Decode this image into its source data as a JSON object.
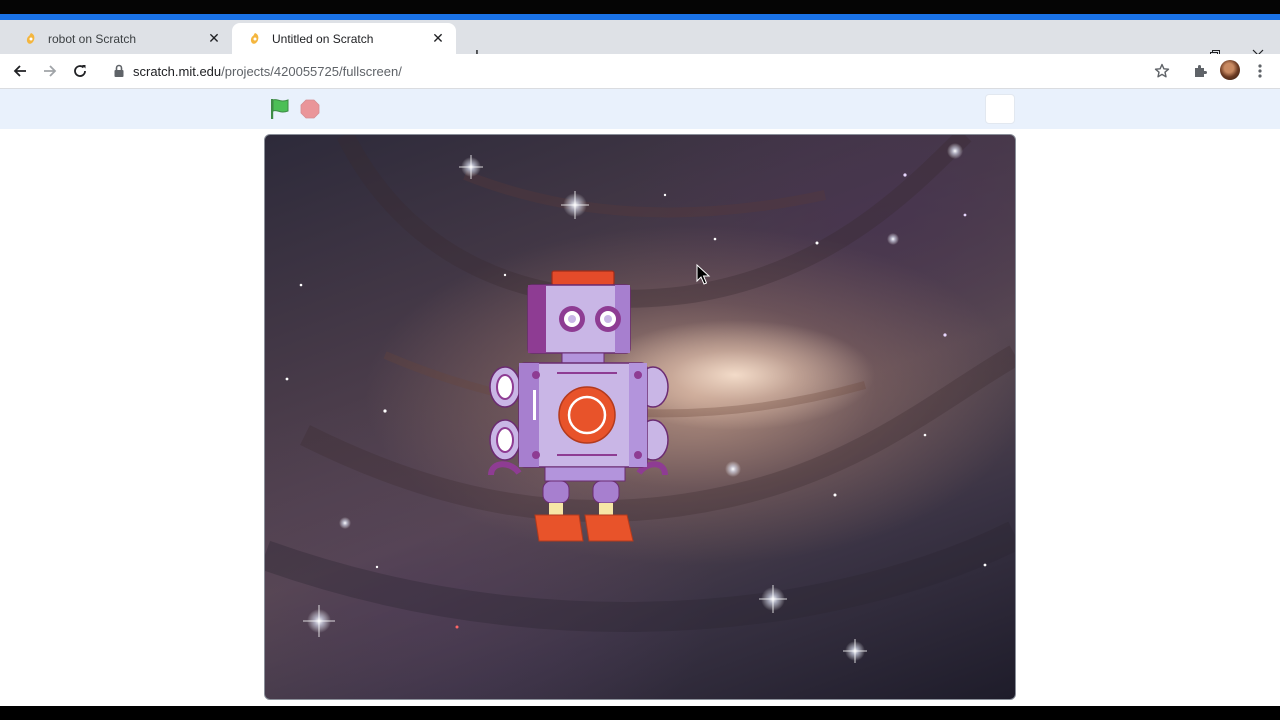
{
  "browser": {
    "tabs": [
      {
        "title": "robot on Scratch",
        "active": false
      },
      {
        "title": "Untitled on Scratch",
        "active": true
      }
    ],
    "url_host": "scratch.mit.edu",
    "url_path": "/projects/420055725/fullscreen/"
  },
  "colors": {
    "accent": "#1a73e8",
    "flag": "#4cbf56",
    "stop": "#ec5959",
    "robot_purple": "#8e3c93",
    "robot_lavender": "#c9b6e6",
    "robot_orange": "#e8532a"
  },
  "icons": [
    "back-icon",
    "forward-icon",
    "reload-icon",
    "lock-icon",
    "star-icon",
    "extensions-icon",
    "menu-icon",
    "green-flag-icon",
    "stop-icon",
    "fullscreen-icon"
  ]
}
